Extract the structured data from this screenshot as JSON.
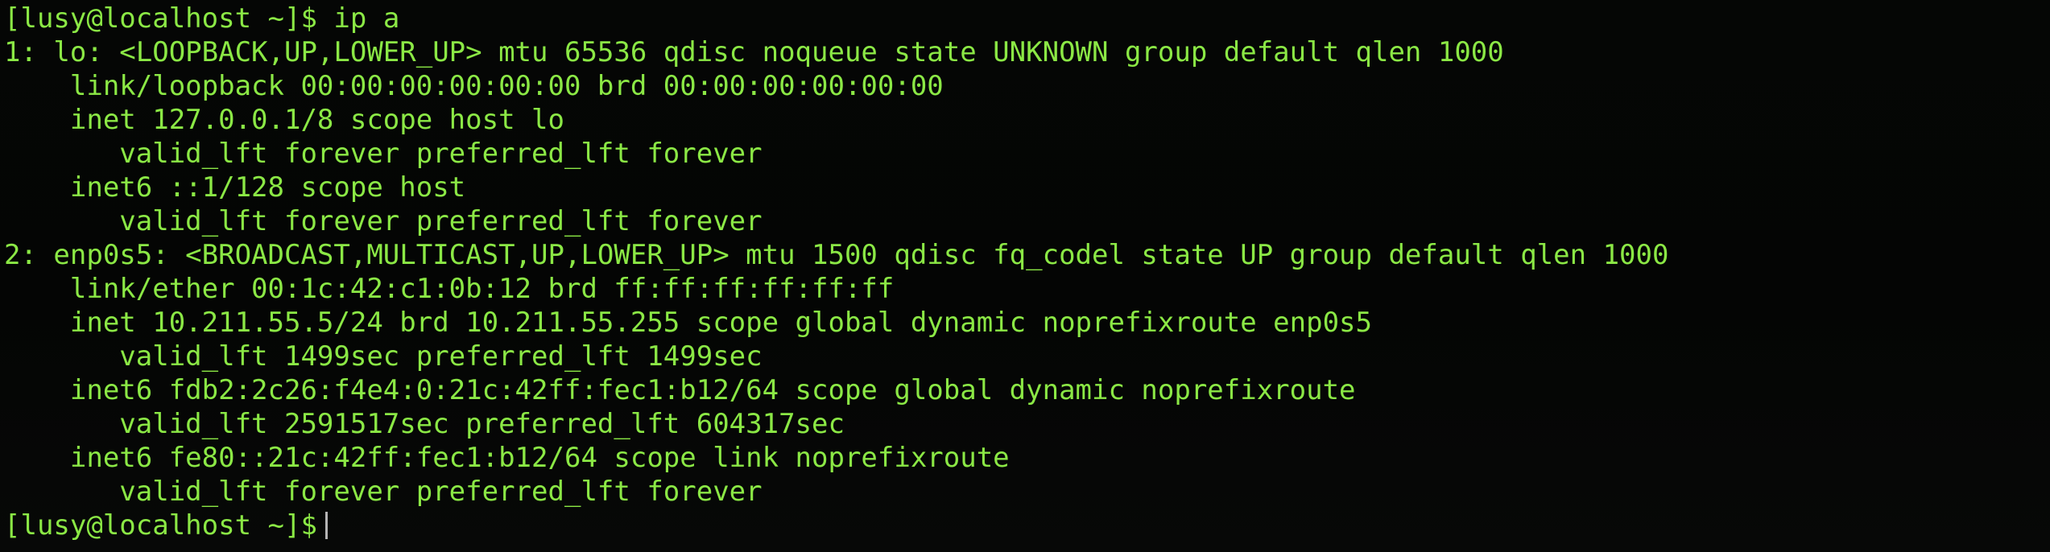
{
  "terminal": {
    "prompt": "[lusy@localhost ~]$",
    "command": "ip a",
    "output_lines": [
      "1: lo: <LOOPBACK,UP,LOWER_UP> mtu 65536 qdisc noqueue state UNKNOWN group default qlen 1000",
      "    link/loopback 00:00:00:00:00:00 brd 00:00:00:00:00:00",
      "    inet 127.0.0.1/8 scope host lo",
      "       valid_lft forever preferred_lft forever",
      "    inet6 ::1/128 scope host",
      "       valid_lft forever preferred_lft forever",
      "2: enp0s5: <BROADCAST,MULTICAST,UP,LOWER_UP> mtu 1500 qdisc fq_codel state UP group default qlen 1000",
      "    link/ether 00:1c:42:c1:0b:12 brd ff:ff:ff:ff:ff:ff",
      "    inet 10.211.55.5/24 brd 10.211.55.255 scope global dynamic noprefixroute enp0s5",
      "       valid_lft 1499sec preferred_lft 1499sec",
      "    inet6 fdb2:2c26:f4e4:0:21c:42ff:fec1:b12/64 scope global dynamic noprefixroute",
      "       valid_lft 2591517sec preferred_lft 604317sec",
      "    inet6 fe80::21c:42ff:fec1:b12/64 scope link noprefixroute",
      "       valid_lft forever preferred_lft forever"
    ],
    "final_prompt": "[lusy@localhost ~]$",
    "colors": {
      "background": "#000000",
      "text": "#8be845",
      "cursor": "#b5b5b5"
    }
  }
}
